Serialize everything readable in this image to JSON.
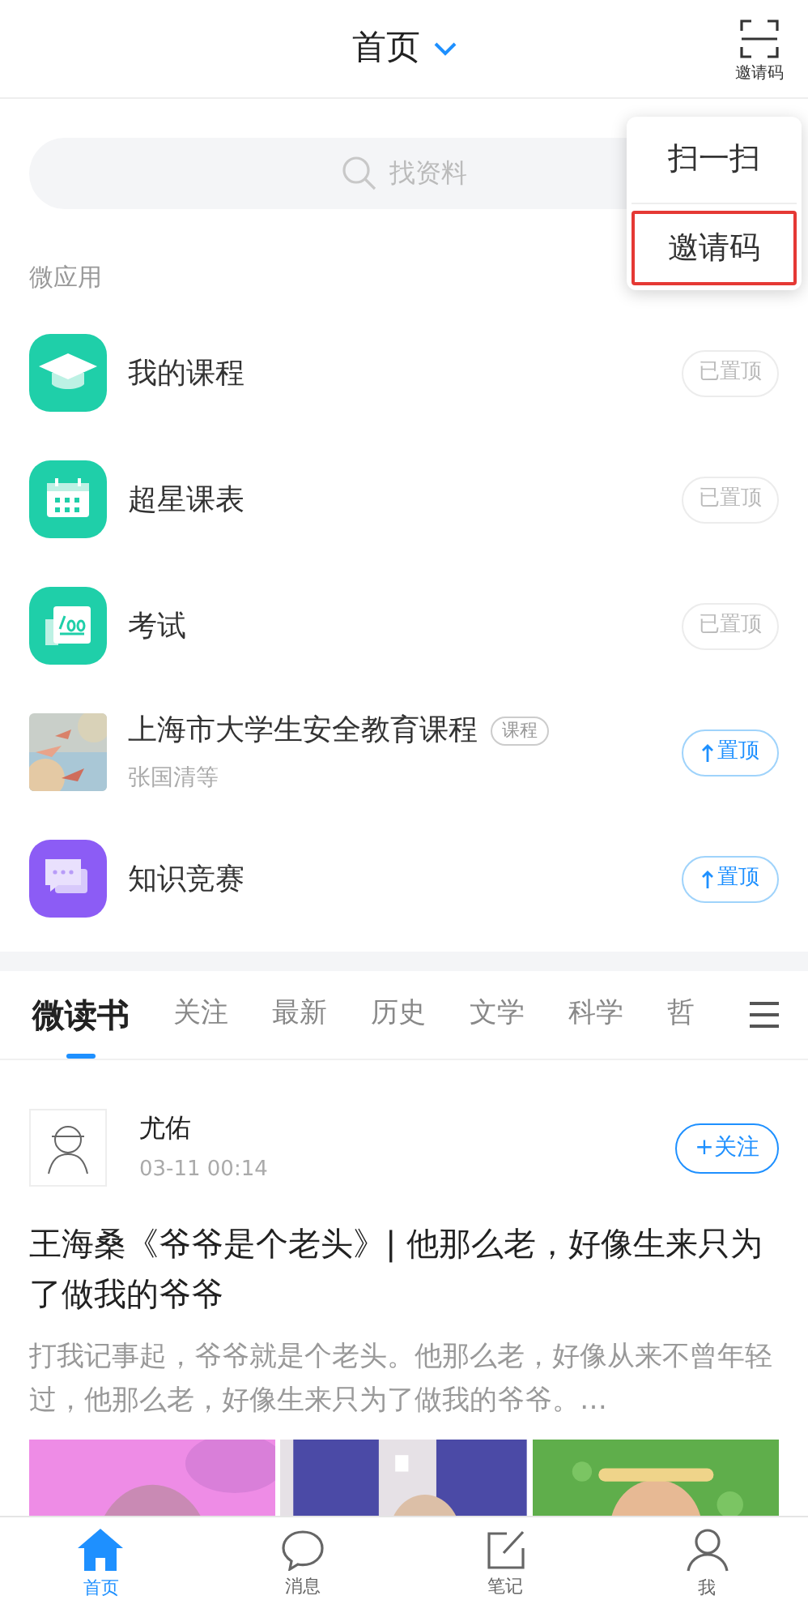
{
  "header": {
    "title": "首页",
    "action_label": "邀请码"
  },
  "popup_menu": [
    {
      "label": "扫一扫",
      "selected": false
    },
    {
      "label": "邀请码",
      "selected": true
    }
  ],
  "search": {
    "placeholder": "找资料"
  },
  "section_title": "微应用",
  "apps": [
    {
      "kind": "app",
      "name": "我的课程",
      "pinned": true,
      "pin_label": "已置顶"
    },
    {
      "kind": "app",
      "name": "超星课表",
      "pinned": true,
      "pin_label": "已置顶"
    },
    {
      "kind": "app",
      "name": "考试",
      "pinned": true,
      "pin_label": "已置顶"
    },
    {
      "kind": "picture",
      "name": "上海市大学生安全教育课程",
      "tag": "课程",
      "subtitle": "张国清等",
      "pinned": false,
      "pin_label": "置顶"
    },
    {
      "kind": "app",
      "name": "知识竞赛",
      "pinned": false,
      "pin_label": "置顶"
    }
  ],
  "tabs": [
    {
      "label": "微读书",
      "selected": true
    },
    {
      "label": "关注",
      "selected": false
    },
    {
      "label": "最新",
      "selected": false
    },
    {
      "label": "历史",
      "selected": false
    },
    {
      "label": "文学",
      "selected": false
    },
    {
      "label": "科学",
      "selected": false
    },
    {
      "label": "哲",
      "selected": false
    }
  ],
  "post": {
    "author": "尤佑",
    "time": "03-11 00:14",
    "follow_label": "+关注",
    "title": "王海桑《爷爷是个老头》| 他那么老，好像生来只为了做我的爷爷",
    "summary": "打我记事起，爷爷就是个老头。他那么老，好像从来不曾年轻过，他那么老，好像生来只为了做我的爷爷。…"
  },
  "bottom_nav": [
    {
      "label": "首页",
      "selected": true
    },
    {
      "label": "消息",
      "selected": false
    },
    {
      "label": "笔记",
      "selected": false
    },
    {
      "label": "我",
      "selected": false
    }
  ]
}
